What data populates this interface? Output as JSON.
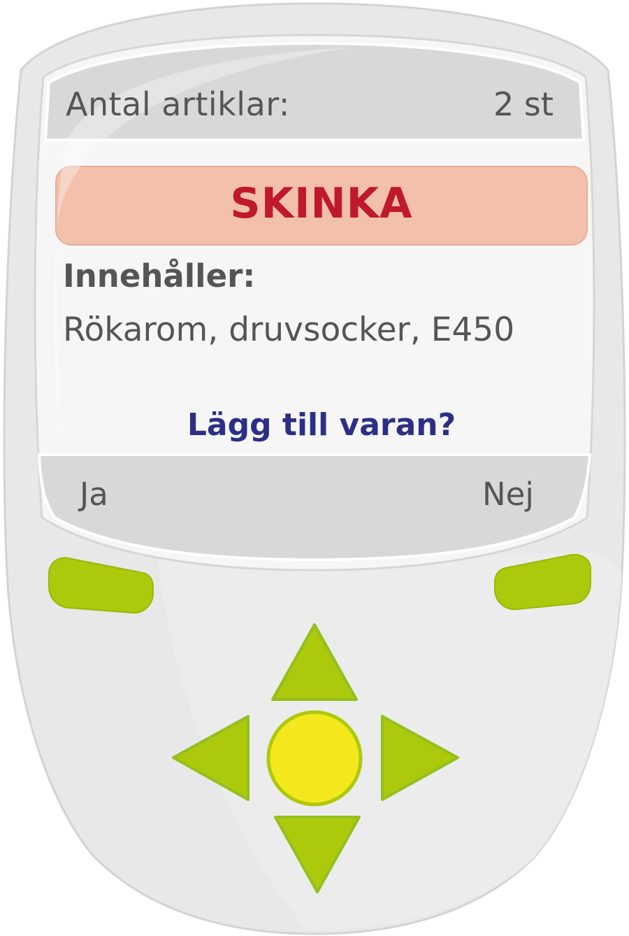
{
  "screen": {
    "counter_label": "Antal artiklar:",
    "counter_value": "2 st",
    "product_name": "SKINKA",
    "contains_label": "Innehåller:",
    "ingredients": "Rökarom, druvsocker, E450",
    "question": "Lägg till varan?",
    "soft_left_label": "Ja",
    "soft_right_label": "Nej"
  },
  "colors": {
    "device_body": "#e9e9e9",
    "screen_bg": "#f3f3f3",
    "product_banner": "#f2c0ab",
    "product_text": "#c0192a",
    "question_text": "#2c2f86",
    "button_green": "#adc90c",
    "center_button": "#f4e81c",
    "label_text": "#555555"
  },
  "icons": [
    "dpad-up-icon",
    "dpad-down-icon",
    "dpad-left-icon",
    "dpad-right-icon"
  ]
}
